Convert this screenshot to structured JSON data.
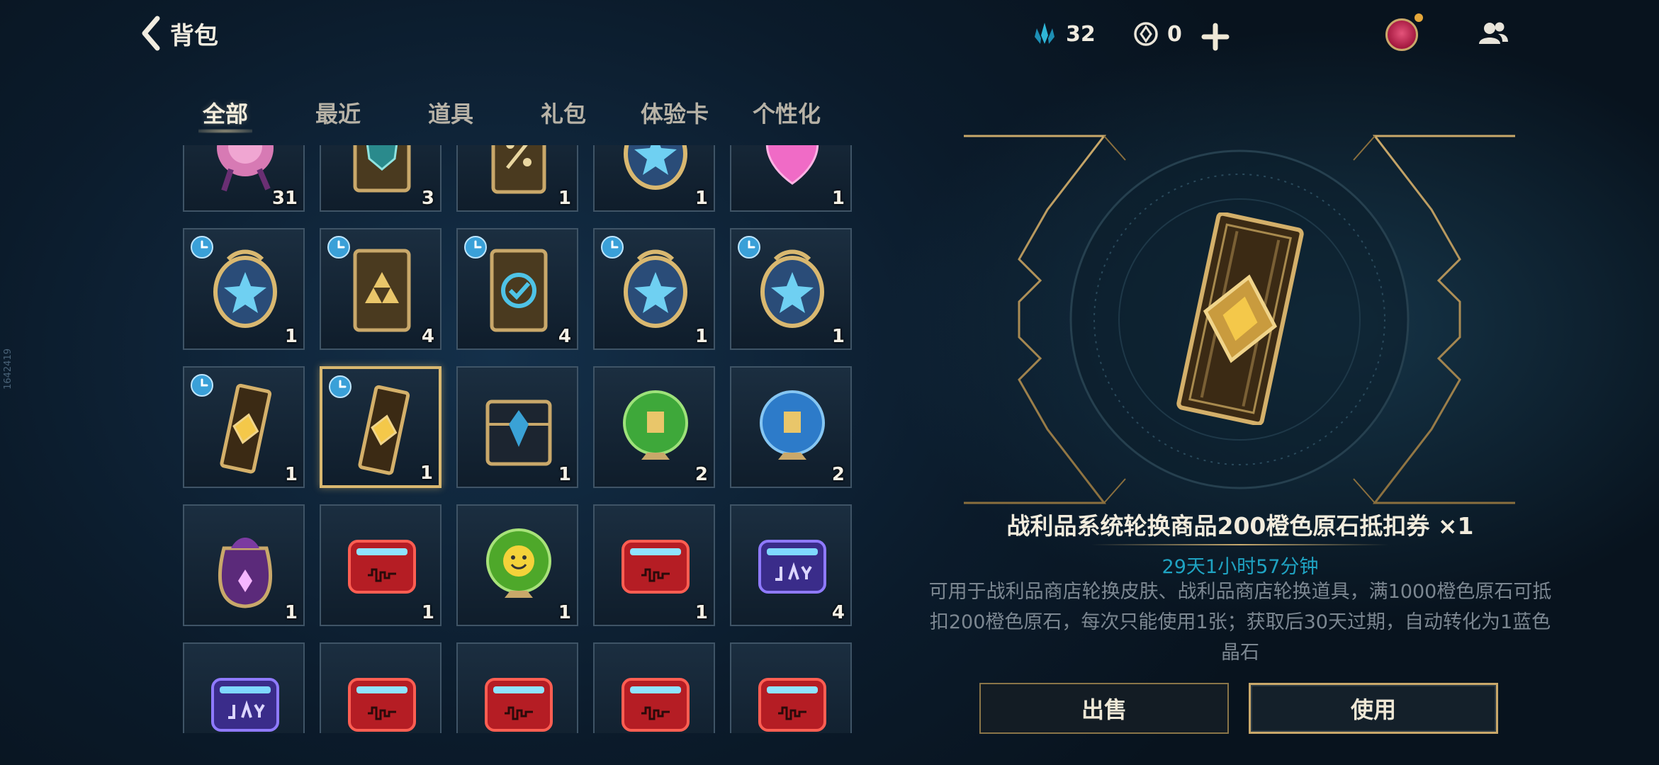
{
  "header": {
    "back_label": "背包",
    "blue_essence": "32",
    "orange_essence": "0"
  },
  "side_id": "1642419",
  "tabs": [
    {
      "label": "全部",
      "active": true
    },
    {
      "label": "最近",
      "active": false
    },
    {
      "label": "道具",
      "active": false
    },
    {
      "label": "礼包",
      "active": false
    },
    {
      "label": "体验卡",
      "active": false
    },
    {
      "label": "个性化",
      "active": false
    }
  ],
  "grid": [
    {
      "icon": "pink-rose-icon",
      "qty": "31",
      "timed": false
    },
    {
      "icon": "shield-card-icon",
      "qty": "3",
      "timed": false
    },
    {
      "icon": "discount-coupon-icon",
      "qty": "1",
      "timed": false
    },
    {
      "icon": "star-capsule-icon",
      "qty": "1",
      "timed": false
    },
    {
      "icon": "pink-heart-icon",
      "qty": "1",
      "timed": false
    },
    {
      "icon": "star-capsule-icon",
      "qty": "1",
      "timed": true
    },
    {
      "icon": "triforce-card-icon",
      "qty": "4",
      "timed": true
    },
    {
      "icon": "refresh-card-icon",
      "qty": "4",
      "timed": true
    },
    {
      "icon": "star-capsule-icon",
      "qty": "1",
      "timed": true
    },
    {
      "icon": "star-capsule-icon",
      "qty": "1",
      "timed": true
    },
    {
      "icon": "gold-ticket-icon",
      "qty": "1",
      "timed": true
    },
    {
      "icon": "gold-ticket-icon",
      "qty": "1",
      "timed": true,
      "selected": true
    },
    {
      "icon": "hextech-chest-icon",
      "qty": "1",
      "timed": false
    },
    {
      "icon": "green-orb-emote-icon",
      "qty": "2",
      "timed": false
    },
    {
      "icon": "blue-orb-emote-icon",
      "qty": "2",
      "timed": false
    },
    {
      "icon": "purple-pouch-icon",
      "qty": "1",
      "timed": false
    },
    {
      "icon": "red-music-box-icon",
      "qty": "1",
      "timed": false
    },
    {
      "icon": "smiley-orb-icon",
      "qty": "1",
      "timed": false
    },
    {
      "icon": "red-music-box-icon",
      "qty": "1",
      "timed": false
    },
    {
      "icon": "jay-music-box-icon",
      "qty": "4",
      "timed": false
    },
    {
      "icon": "jay-music-box-icon",
      "qty": "",
      "timed": false
    },
    {
      "icon": "red-music-box-icon",
      "qty": "",
      "timed": false
    },
    {
      "icon": "red-music-box-icon",
      "qty": "",
      "timed": false
    },
    {
      "icon": "red-music-box-icon",
      "qty": "",
      "timed": false
    },
    {
      "icon": "red-music-box-icon",
      "qty": "",
      "timed": false
    }
  ],
  "detail": {
    "name": "战利品系统轮换商品200橙色原石抵扣券 ×1",
    "time_left": "29天1小时57分钟",
    "description": "可用于战利品商店轮换皮肤、战利品商店轮换道具，满1000橙色原石可抵扣200橙色原石，每次只能使用1张；获取后30天过期，自动转化为1蓝色晶石",
    "sell_label": "出售",
    "use_label": "使用"
  },
  "colors": {
    "accent_gold": "#c9a86a",
    "time_cyan": "#1fa3c2",
    "bg_dark": "#0b1b2b"
  }
}
